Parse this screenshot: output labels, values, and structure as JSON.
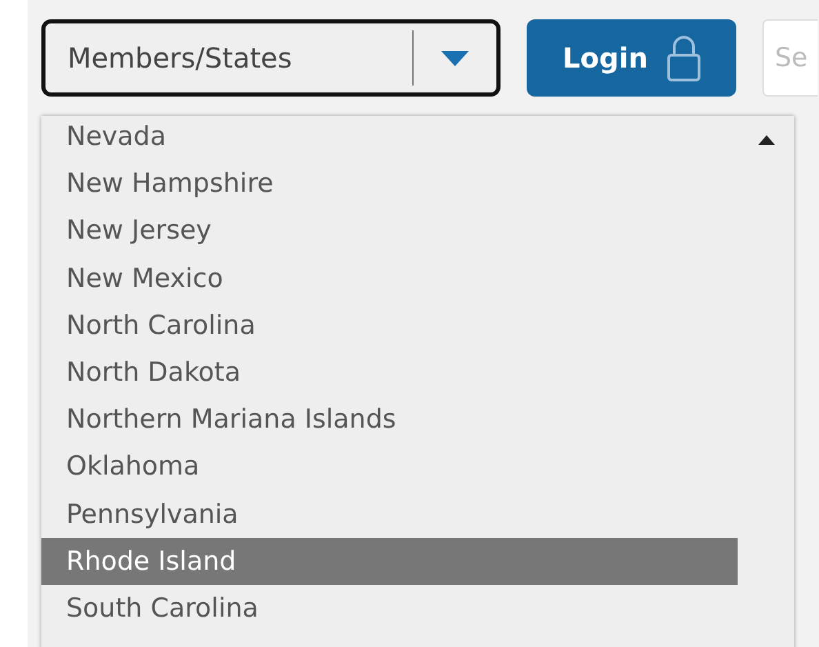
{
  "state_select": {
    "value": "Members/States",
    "expanded": true
  },
  "login_button": {
    "label": "Login"
  },
  "search": {
    "placeholder": "Se"
  },
  "options": [
    {
      "label": "Nevada",
      "selected": false
    },
    {
      "label": "New Hampshire",
      "selected": false
    },
    {
      "label": "New Jersey",
      "selected": false
    },
    {
      "label": "New Mexico",
      "selected": false
    },
    {
      "label": "North Carolina",
      "selected": false
    },
    {
      "label": "North Dakota",
      "selected": false
    },
    {
      "label": "Northern Mariana Islands",
      "selected": false
    },
    {
      "label": "Oklahoma",
      "selected": false
    },
    {
      "label": "Pennsylvania",
      "selected": false
    },
    {
      "label": "Rhode Island",
      "selected": true
    },
    {
      "label": "South Carolina",
      "selected": false
    }
  ]
}
